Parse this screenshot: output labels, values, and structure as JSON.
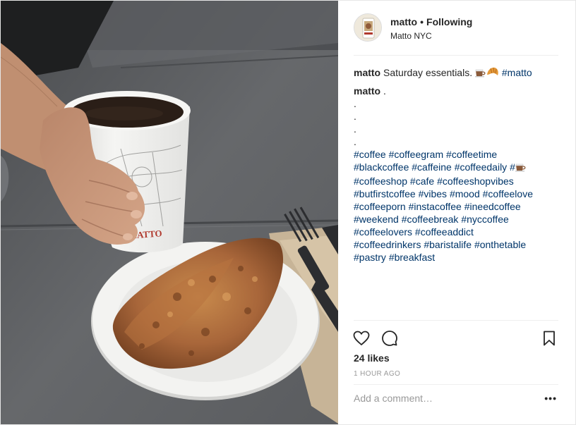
{
  "post": {
    "username": "matto",
    "follow_status": "Following",
    "location": "Matto NYC",
    "photo_alt": "Coffee cup held by a hand next to a pastry on a plate",
    "cup_brand": "MATTO"
  },
  "caption": {
    "username": "matto",
    "text": "Saturday essentials.",
    "emojis": [
      "coffee-icon",
      "croissant-icon"
    ],
    "first_tag": "#matto",
    "second_comment_user": "matto",
    "second_comment_text": ".",
    "dots": [
      ".",
      ".",
      ".",
      "."
    ],
    "hashtag_lines": [
      [
        "#coffee",
        "#coffeegram",
        "#coffeetime"
      ],
      [
        "#blackcoffee",
        "#caffeine",
        "#coffeedaily",
        "#"
      ],
      [
        "#coffeeshop",
        "#cafe",
        "#coffeeshopvibes"
      ],
      [
        "#butfirstcoffee",
        "#vibes",
        "#mood",
        "#coffeelove"
      ],
      [
        "#coffeeporn",
        "#instacoffee",
        "#ineedcoffee"
      ],
      [
        "#weekend",
        "#coffeebreak",
        "#nyccoffee"
      ],
      [
        "#coffeelovers",
        "#coffeeaddict"
      ],
      [
        "#coffeedrinkers",
        "#baristalife",
        "#onthetable"
      ],
      [
        "#pastry",
        "#breakfast"
      ]
    ]
  },
  "actions": {
    "like_icon": "heart-icon",
    "comment_icon": "comment-icon",
    "save_icon": "bookmark-icon",
    "likes": "24 likes",
    "time": "1 HOUR AGO"
  },
  "comment_box": {
    "placeholder": "Add a comment…",
    "more_label": "•••"
  }
}
